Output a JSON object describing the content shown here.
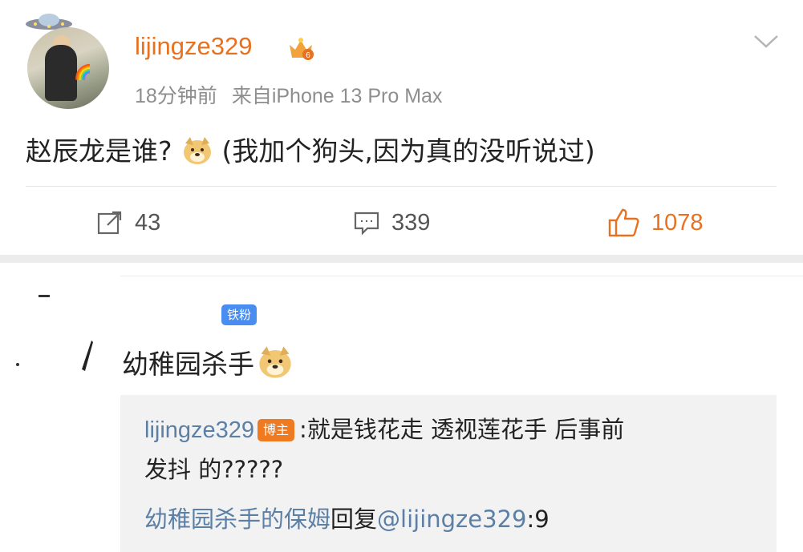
{
  "post": {
    "username": "lijingze329",
    "level_badge": "6",
    "time": "18分钟前",
    "source": "来自iPhone 13 Pro Max",
    "text_before": "赵辰龙是谁?",
    "text_after": "(我加个狗头,因为真的没听说过)",
    "actions": {
      "repost_count": "43",
      "comment_count": "339",
      "like_count": "1078"
    },
    "accent_color": "#e8711f"
  },
  "reply": {
    "fan_badge": "铁粉",
    "commenter_name": "幼稚园杀手",
    "quote": {
      "user": "lijingze329",
      "host_badge": "博主",
      "text_line1": ":就是钱花走 透视莲花手 后事前",
      "text_line2": "发抖 的?????",
      "reply_author": "幼稚园杀手的保姆",
      "reply_word": "回复",
      "reply_mention": "@lijingze329",
      "reply_text": ":9"
    },
    "link_color": "#5c7fa6"
  }
}
